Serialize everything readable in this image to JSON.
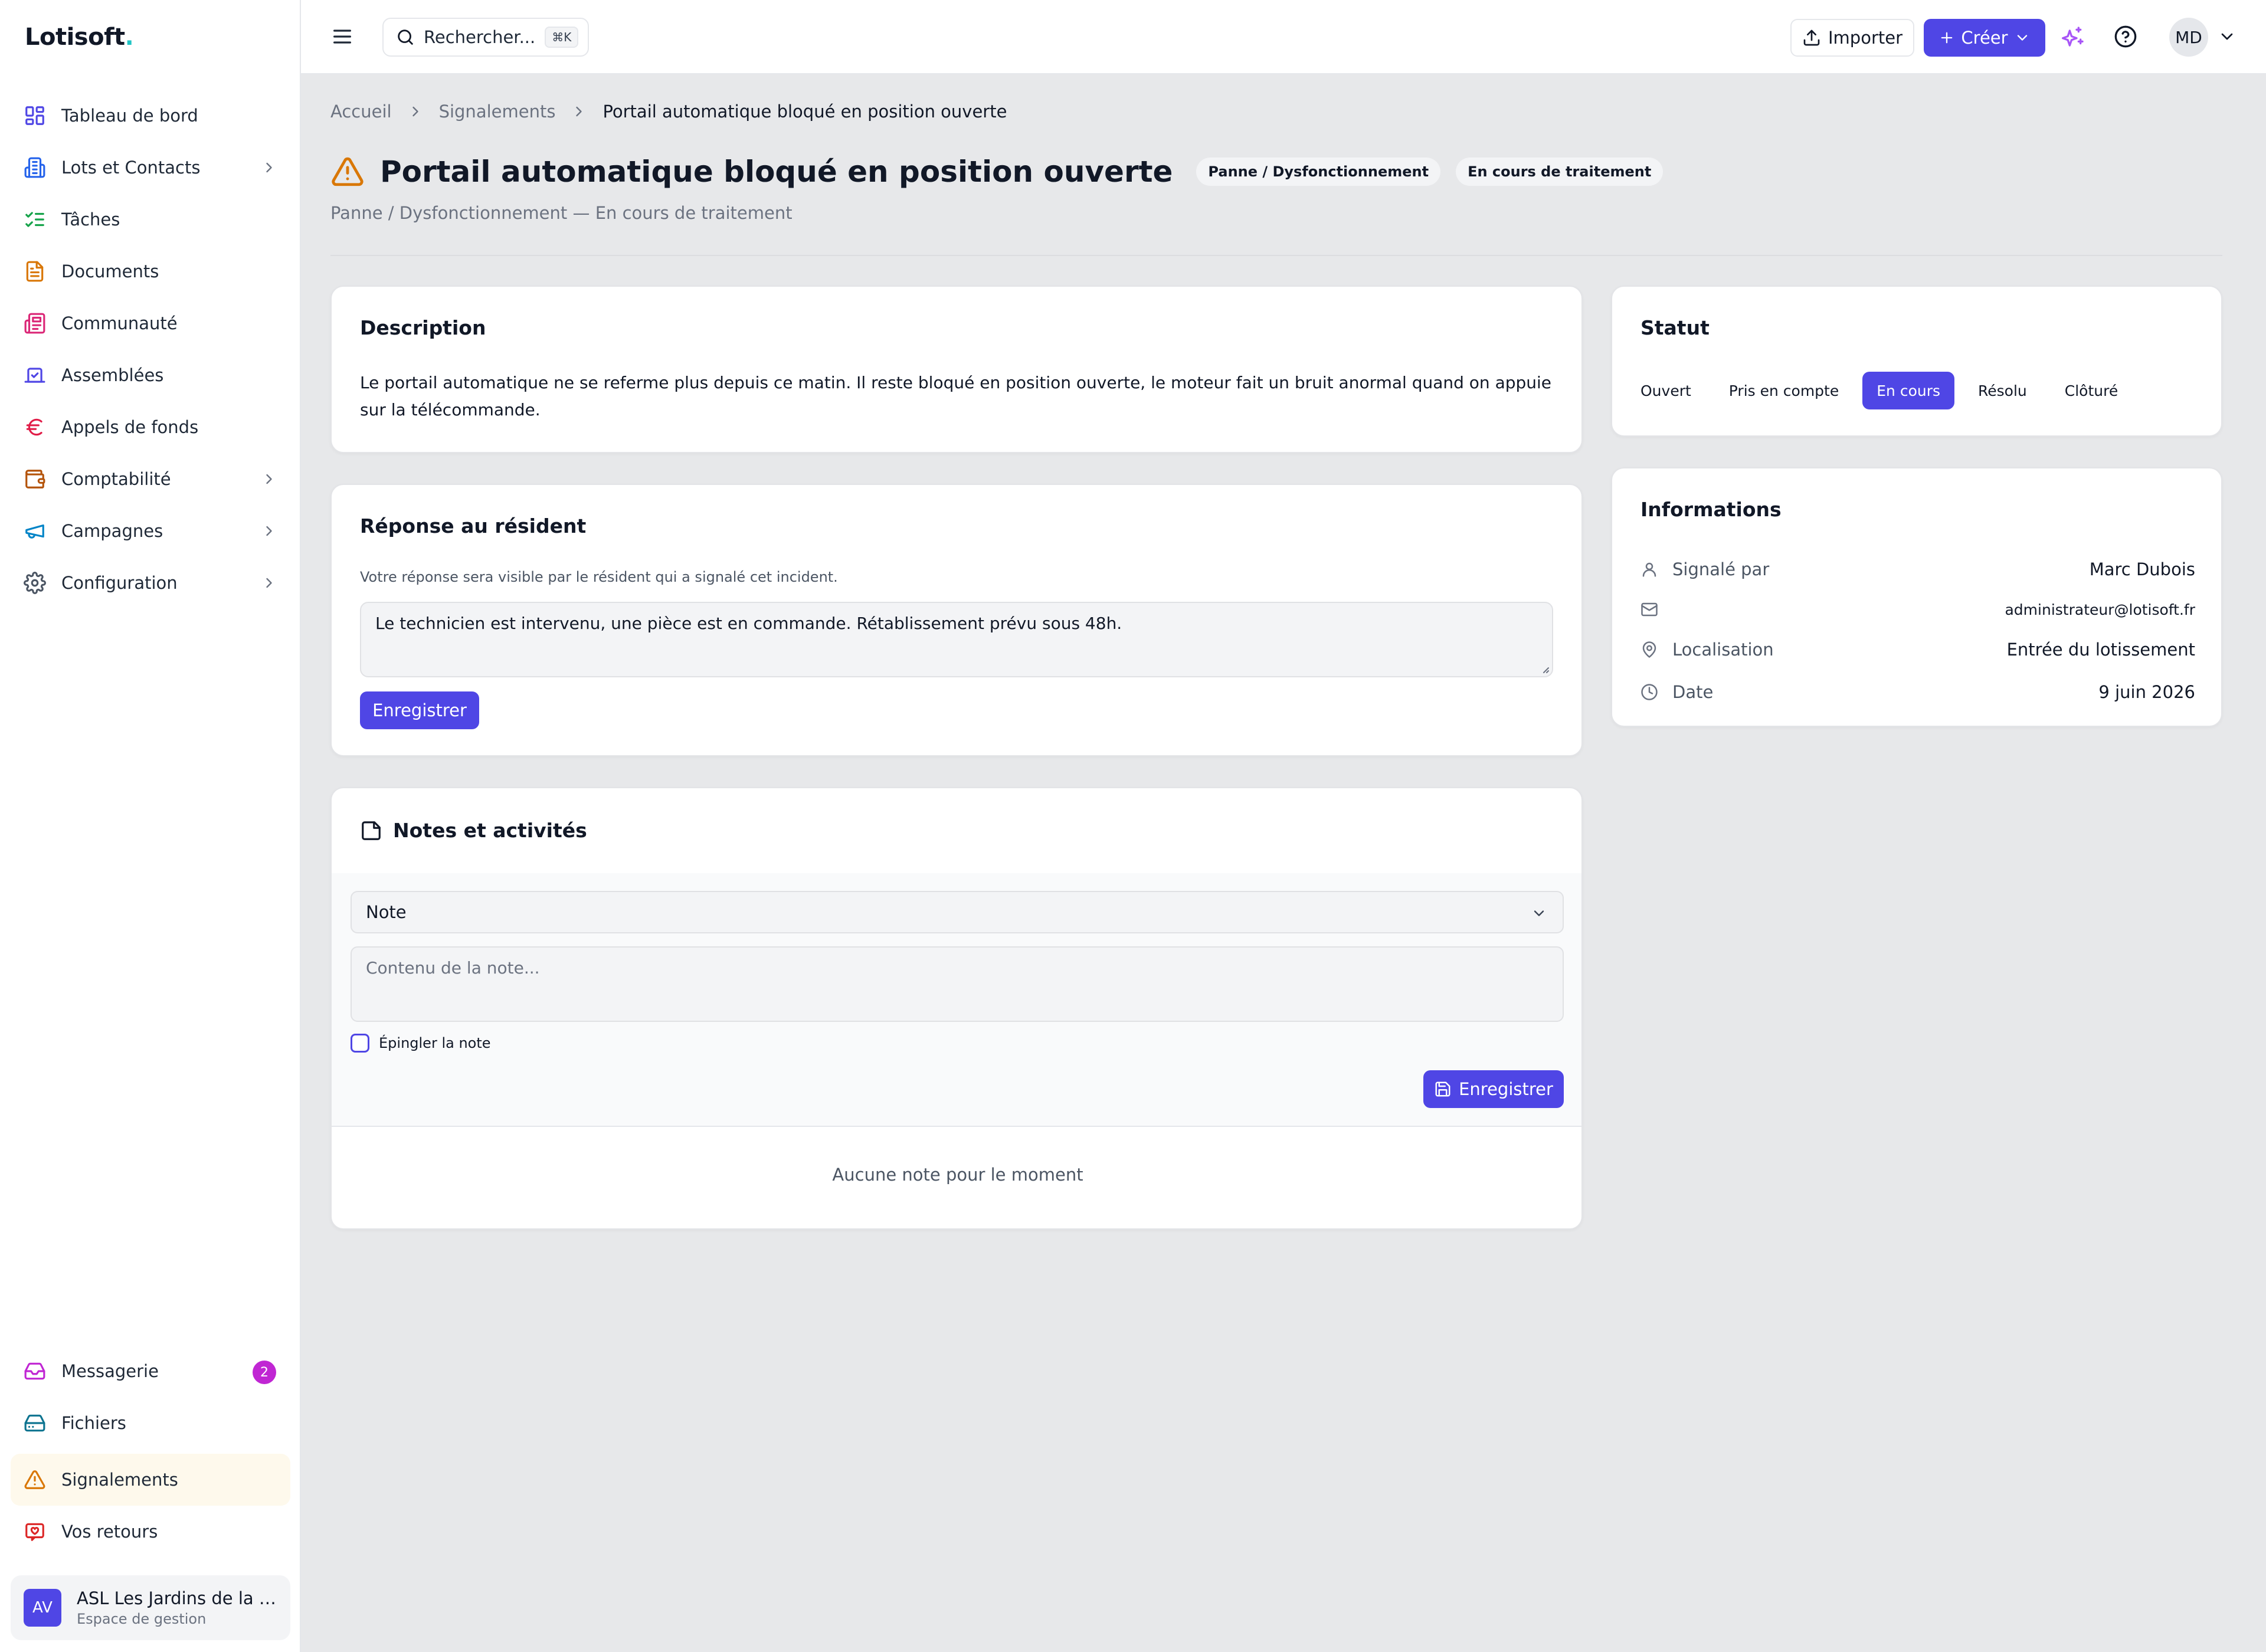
{
  "app": {
    "logo": "Lotisoft",
    "logo_dot": "."
  },
  "topbar": {
    "search_placeholder": "Rechercher...",
    "search_shortcut": "⌘K",
    "import_label": "Importer",
    "create_label": "Créer",
    "user_initials": "MD"
  },
  "sidebar": {
    "items": [
      {
        "label": "Tableau de bord",
        "icon": "dashboard-icon",
        "color": "#4f46e5"
      },
      {
        "label": "Lots et Contacts",
        "icon": "building-icon",
        "color": "#2563eb"
      },
      {
        "label": "Tâches",
        "icon": "checklist-icon",
        "color": "#16a34a"
      },
      {
        "label": "Documents",
        "icon": "document-icon",
        "color": "#d97706"
      },
      {
        "label": "Communauté",
        "icon": "newspaper-icon",
        "color": "#db2777"
      },
      {
        "label": "Assemblées",
        "icon": "vote-icon",
        "color": "#4f46e5"
      },
      {
        "label": "Appels de fonds",
        "icon": "euro-icon",
        "color": "#e11d48"
      },
      {
        "label": "Comptabilité",
        "icon": "wallet-icon",
        "color": "#b45309"
      },
      {
        "label": "Campagnes",
        "icon": "megaphone-icon",
        "color": "#0284c7"
      },
      {
        "label": "Configuration",
        "icon": "gear-icon",
        "color": "#4b5563"
      }
    ],
    "bottom_items": [
      {
        "label": "Messagerie",
        "icon": "inbox-icon",
        "color": "#c026d3",
        "badge": "2"
      },
      {
        "label": "Fichiers",
        "icon": "drive-icon",
        "color": "#0e7490"
      },
      {
        "label": "Signalements",
        "icon": "warning-icon",
        "color": "#d97706"
      },
      {
        "label": "Vos retours",
        "icon": "feedback-icon",
        "color": "#dc2626"
      }
    ],
    "org": {
      "initials": "AV",
      "name": "ASL Les Jardins de la Vallée",
      "sub": "Espace de gestion"
    }
  },
  "breadcrumb": [
    "Accueil",
    "Signalements",
    "Portail automatique bloqué en position ouverte"
  ],
  "page": {
    "title": "Portail automatique bloqué en position ouverte",
    "chip_category": "Panne / Dysfonctionnement",
    "chip_status": "En cours de traitement",
    "subtitle": "Panne / Dysfonctionnement — En cours de traitement"
  },
  "description": {
    "title": "Description",
    "text": "Le portail automatique ne se referme plus depuis ce matin. Il reste bloqué en position ouverte, le moteur fait un bruit anormal quand on appuie sur la télécommande."
  },
  "response": {
    "title": "Réponse au résident",
    "hint": "Votre réponse sera visible par le résident qui a signalé cet incident.",
    "value": "Le technicien est intervenu, une pièce est en commande. Rétablissement prévu sous 48h.",
    "save_label": "Enregistrer"
  },
  "notes": {
    "title": "Notes et activités",
    "type_value": "Note",
    "content_placeholder": "Contenu de la note...",
    "pin_label": "Épingler la note",
    "save_label": "Enregistrer",
    "empty": "Aucune note pour le moment"
  },
  "status": {
    "title": "Statut",
    "tabs": [
      "Ouvert",
      "Pris en compte",
      "En cours",
      "Résolu",
      "Clôturé"
    ],
    "active": "En cours",
    "accent": "#4f46e5"
  },
  "info": {
    "title": "Informations",
    "reporter_label": "Signalé par",
    "reporter": "Marc Dubois",
    "email": "administrateur@lotisoft.fr",
    "location_label": "Localisation",
    "location": "Entrée du lotissement",
    "date_label": "Date",
    "date": "9 juin 2026"
  }
}
